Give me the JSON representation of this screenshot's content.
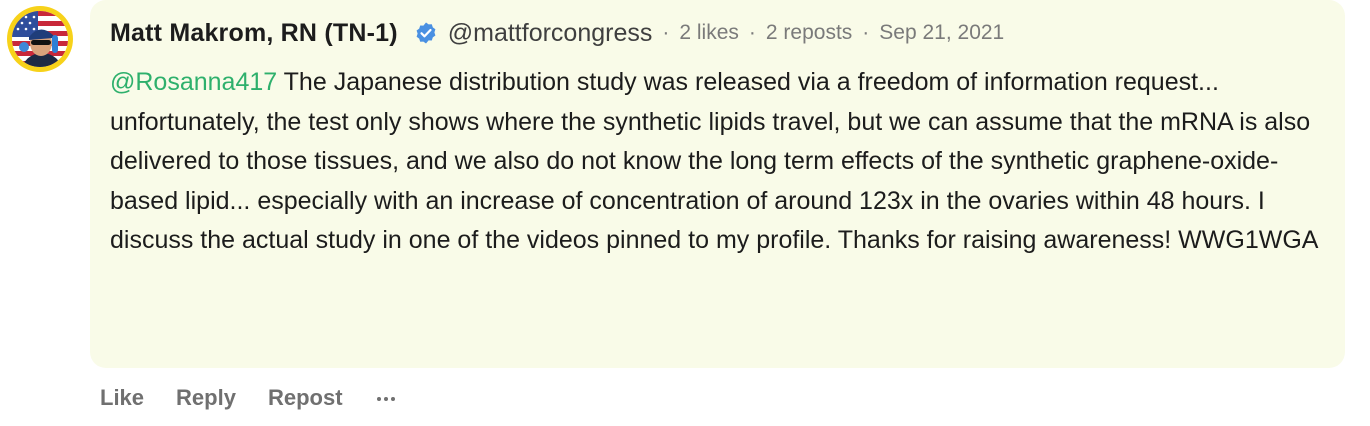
{
  "post": {
    "author": {
      "name": "Matt Makrom, RN (TN-1)",
      "handle": "@mattforcongress",
      "verified_icon": "verified-check-icon",
      "avatar_colors": {
        "ring": "#f7d21a",
        "flag_red": "#c8283a",
        "flag_blue": "#2f4e9c"
      }
    },
    "separator": "·",
    "likes": "2 likes",
    "reposts": "2 reposts",
    "date": "Sep 21, 2021",
    "mention": "@Rosanna417",
    "text": " The Japanese distribution study was released via a freedom of information request... unfortunately, the test only shows where the synthetic lipids travel, but we can assume that the mRNA is also delivered to those tissues, and we also do not know the long term effects of the synthetic graphene-oxide-based lipid... especially with an increase of concentration of around 123x in the ovaries within 48 hours. I discuss the actual study in one of the videos pinned to my profile. Thanks for raising awareness! WWG1WGA",
    "colors": {
      "bubble_bg": "#f9fbe8",
      "mention": "#2eb06c",
      "verified": "#4a90e2"
    }
  },
  "actions": {
    "like": "Like",
    "reply": "Reply",
    "repost": "Repost",
    "more_icon": "ellipsis-icon"
  }
}
